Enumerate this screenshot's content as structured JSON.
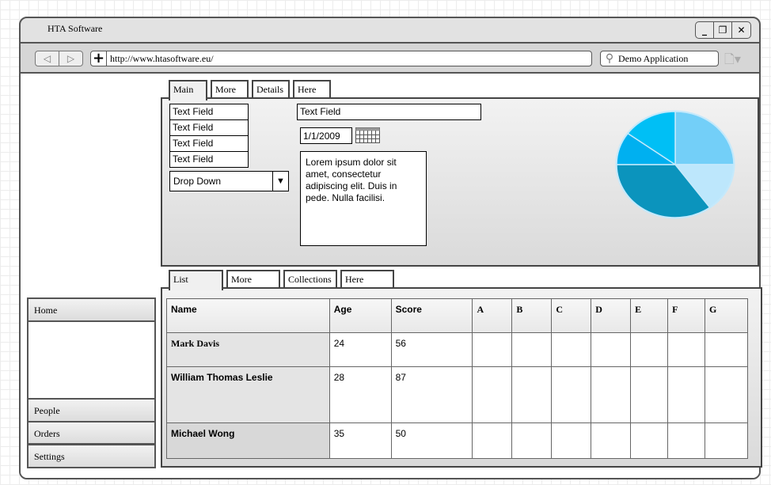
{
  "window": {
    "title": "HTA Software",
    "controls": [
      "minimize",
      "restore",
      "close"
    ]
  },
  "toolbar": {
    "url": "http://www.htasoftware.eu/",
    "search": "Demo Application"
  },
  "top_tabs": [
    "Main",
    "More",
    "Details",
    "Here"
  ],
  "form": {
    "text_fields": [
      "Text Field",
      "Text Field",
      "Text Field",
      "Text Field"
    ],
    "wide_field": "Text Field",
    "dropdown": "Drop Down",
    "date": "1/1/2009",
    "textarea": "Lorem ipsum dolor sit amet, consectetur adipiscing elit. Duis in pede. Nulla facilisi."
  },
  "pie": {
    "colors": [
      "#73cff8",
      "#bde7fc",
      "#0b94bd",
      "#00b0f0",
      "#00bff5"
    ],
    "values": [
      25,
      15,
      35,
      10,
      15
    ]
  },
  "bottom_tabs": [
    "List",
    "More",
    "Collections",
    "Here"
  ],
  "table": {
    "headers": [
      "Name",
      "Age",
      "Score",
      "A",
      "B",
      "C",
      "D",
      "E",
      "F",
      "G"
    ],
    "rows": [
      [
        "Mark Davis",
        "24",
        "56"
      ],
      [
        "William Thomas Leslie",
        "28",
        "87"
      ],
      [
        "Michael Wong",
        "35",
        "50"
      ]
    ]
  },
  "sidebar": {
    "items": [
      "Home",
      "People",
      "Orders",
      "Settings"
    ]
  }
}
